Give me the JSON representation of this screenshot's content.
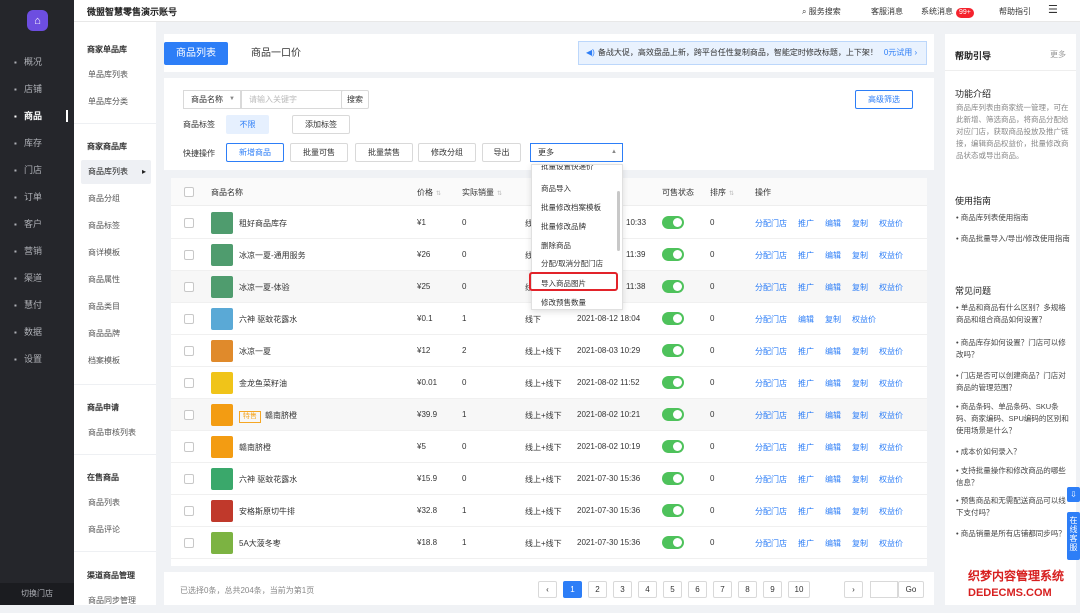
{
  "topbar": {
    "brand": "微盟智慧零售演示账号",
    "search": "服务搜索",
    "messages": "客服消息",
    "system": "系统消息",
    "badge": "99+",
    "guide": "帮助指引"
  },
  "nav": {
    "items": [
      "概况",
      "店铺",
      "商品",
      "库存",
      "门店",
      "订单",
      "客户",
      "营销",
      "渠道",
      "慧付",
      "数据",
      "设置"
    ],
    "bottom": "切换门店"
  },
  "subnav": {
    "sec1": "商家单品库",
    "s1a": "单品库列表",
    "s1b": "单品库分类",
    "sec2": "商家商品库",
    "s2a": "商品库列表",
    "s2b": "商品分组",
    "s2c": "商品标签",
    "s2d": "商详模板",
    "s2e": "商品属性",
    "s2f": "商品类目",
    "s2g": "商品品牌",
    "s2h": "档案模板",
    "sec3": "商品申请",
    "s3a": "商品审核列表",
    "sec4": "在售商品",
    "s4a": "商品列表",
    "s4b": "商品评论",
    "sec5": "渠道商品管理",
    "s5a": "商品同步管理"
  },
  "tabs": {
    "active": "商品列表",
    "other": "商品一口价"
  },
  "notice": {
    "text": "备战大促，高效盘品上新，跨平台任性复制商品，智能定时修改标题，上下架！",
    "link": "0元试用 ›"
  },
  "filter": {
    "field_select": "商品名称",
    "search_placeholder": "请输入关键字",
    "search_btn": "搜索",
    "advanced": "高级筛选",
    "tag_label": "商品标签",
    "tag_none": "不限",
    "tag_add": "添加标签",
    "quick_label": "快捷操作",
    "q_new": "新增商品",
    "q_sell": "批量可售",
    "q_ban": "批量禁售",
    "q_group": "修改分组",
    "q_export": "导出",
    "q_more": "更多"
  },
  "dropdown": {
    "items": [
      "批量设置快递价",
      "商品导入",
      "批量修改档案模板",
      "批量修改品牌",
      "删除商品",
      "分配/取消分配门店",
      "导入商品图片",
      "修改预售数量"
    ],
    "highlighted": "导入商品图片"
  },
  "table": {
    "headers": {
      "name": "商品名称",
      "price": "价格",
      "sales": "实际销量",
      "channel": "销售渠道",
      "time": "创建时间",
      "status": "可售状态",
      "sort": "排序",
      "ops": "操作"
    },
    "ops": [
      "分配门店",
      "推广",
      "编辑",
      "复制",
      "权益价"
    ],
    "ops_short": [
      "分配门店",
      "编辑",
      "复制",
      "权益价"
    ],
    "rows": [
      {
        "name": "租好商品库存",
        "price": "¥1",
        "sales": "0",
        "channel": "线",
        "time": "10:33",
        "sort": "0",
        "thumb": "#4f9c6e",
        "alt": false,
        "short": false,
        "tag": ""
      },
      {
        "name": "冰凉一夏-通用服务",
        "price": "¥26",
        "sales": "0",
        "channel": "线",
        "time": "11:39",
        "sort": "0",
        "thumb": "#4f9c6e",
        "alt": false,
        "short": false,
        "tag": ""
      },
      {
        "name": "冰凉一夏-体验",
        "price": "¥25",
        "sales": "0",
        "channel": "线",
        "time": "11:38",
        "sort": "0",
        "thumb": "#4f9c6e",
        "alt": true,
        "short": false,
        "tag": ""
      },
      {
        "name": "六神 驱蚊花露水",
        "price": "¥0.1",
        "sales": "1",
        "channel": "线下",
        "time": "2021-08-12 18:04",
        "sort": "0",
        "thumb": "#5aa9d6",
        "alt": false,
        "short": true,
        "tag": ""
      },
      {
        "name": "冰凉一夏",
        "price": "¥12",
        "sales": "2",
        "channel": "线上+线下",
        "time": "2021-08-03 10:29",
        "sort": "0",
        "thumb": "#e08a2b",
        "alt": false,
        "short": false,
        "tag": ""
      },
      {
        "name": "金龙鱼菜籽油",
        "price": "¥0.01",
        "sales": "0",
        "channel": "线上+线下",
        "time": "2021-08-02 11:52",
        "sort": "0",
        "thumb": "#f0c419",
        "alt": false,
        "short": false,
        "tag": ""
      },
      {
        "name": "赣南脐橙",
        "price": "¥39.9",
        "sales": "1",
        "channel": "线上+线下",
        "time": "2021-08-02 10:21",
        "sort": "0",
        "thumb": "#f39c12",
        "alt": true,
        "short": false,
        "tag": "特售"
      },
      {
        "name": "赣南脐橙",
        "price": "¥5",
        "sales": "0",
        "channel": "线上+线下",
        "time": "2021-08-02 10:19",
        "sort": "0",
        "thumb": "#f39c12",
        "alt": false,
        "short": false,
        "tag": ""
      },
      {
        "name": "六神 驱蚊花露水",
        "price": "¥15.9",
        "sales": "0",
        "channel": "线上+线下",
        "time": "2021-07-30 15:36",
        "sort": "0",
        "thumb": "#3aa86b",
        "alt": false,
        "short": false,
        "tag": ""
      },
      {
        "name": "安格斯原切牛排",
        "price": "¥32.8",
        "sales": "1",
        "channel": "线上+线下",
        "time": "2021-07-30 15:36",
        "sort": "0",
        "thumb": "#c0392b",
        "alt": false,
        "short": false,
        "tag": ""
      },
      {
        "name": "5A大菠冬枣",
        "price": "¥18.8",
        "sales": "1",
        "channel": "线上+线下",
        "time": "2021-07-30 15:36",
        "sort": "0",
        "thumb": "#7cb342",
        "alt": false,
        "short": false,
        "tag": ""
      }
    ]
  },
  "footer": {
    "summary": "已选择0条，总共204条，当前为第1页",
    "pages": [
      "1",
      "2",
      "3",
      "4",
      "5",
      "6",
      "7",
      "8",
      "9",
      "10"
    ],
    "go": "Go"
  },
  "help": {
    "title": "帮助引导",
    "more": "更多",
    "s1": "功能介绍",
    "s1text": "商品库列表由商家统一管理，可在此新增、筛选商品，将商品分配给对应门店，获取商品投放及推广链接，编辑商品权益价，批量修改商品状态或导出商品。",
    "s2": "使用指南",
    "g1": "• 商品库列表使用指南",
    "g2": "• 商品批量导入/导出/修改使用指南",
    "s3": "常见问题",
    "f1": "• 单品和商品有什么区别？多规格商品和组合商品如何设置？",
    "f2": "• 商品库存如何设置？门店可以修改吗？",
    "f3": "• 门店是否可以创建商品？门店对商品的管理范围？",
    "f4": "• 商品条码、单品条码、SKU条码、商家编码、SPU编码的区别和使用场景是什么？",
    "f5": "• 成本价如何录入？",
    "f6": "• 支持批量操作和修改商品的哪些信息？",
    "f7": "• 预售商品和无需配送商品可以线下支付吗？",
    "f8": "• 商品销量是所有店铺都同步吗？"
  },
  "floating": {
    "service": "在线客服"
  },
  "watermark": {
    "l1": "织梦内容管理系统",
    "l2": "DEDECMS.COM"
  }
}
